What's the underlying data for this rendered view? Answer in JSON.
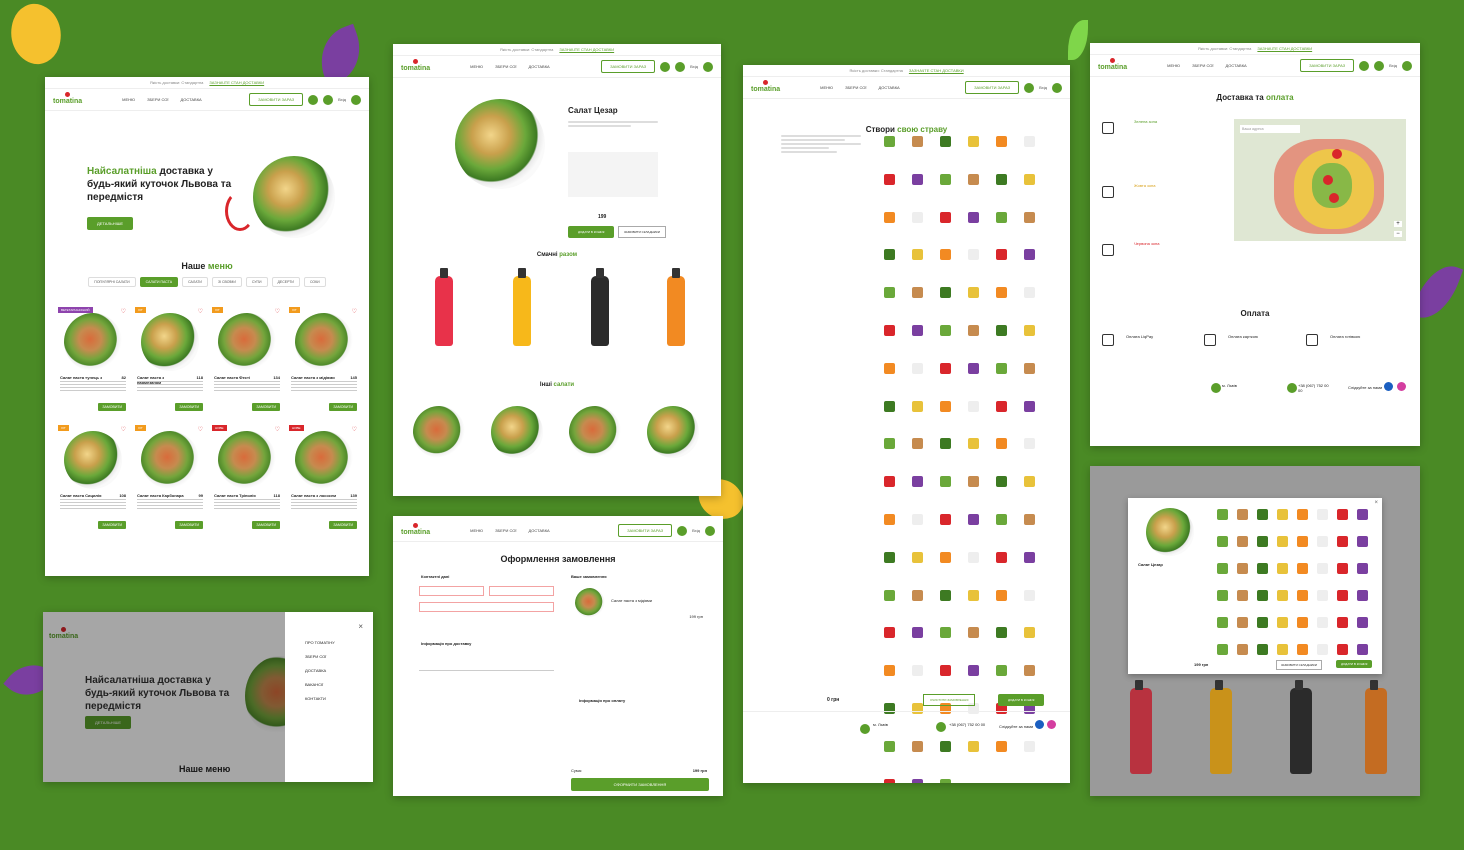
{
  "brand": {
    "name": "tomatina",
    "accent": "#5a9e2a",
    "red": "#d9262b",
    "bg": "#4a8a25"
  },
  "topbar": {
    "text": "Якість доставки: Стандартна",
    "link": "ЗАЗНАЧТЕ СТАН ДОСТАВКИ"
  },
  "nav": {
    "items": [
      "МЕНЮ",
      "ЗБЕРИ СОЇ",
      "ДОСТАВКА"
    ],
    "cta": "ЗАМОВИТИ ЗАРАЗ",
    "login": "Вхід"
  },
  "home": {
    "hero_title_1": "Найсалатніша",
    "hero_title_2": "доставка у будь-який куточок Львова та передмістя",
    "hero_btn": "ДЕТАЛЬНІШЕ",
    "menu_title_1": "Наше",
    "menu_title_2": "меню",
    "tabs": [
      "ПОПУЛЯРНІ САЛАТИ",
      "САЛАТИ ПАСТА",
      "САЛАТИ",
      "ЗІ СВОЇМИ",
      "СУПИ",
      "ДЕСЕРТИ",
      "СОКИ"
    ],
    "cards": [
      {
        "name": "Салат паста тунець з",
        "price": "82",
        "tag": "ВЕГЕТАРІАНСЬКИЙ",
        "tag_type": "p"
      },
      {
        "name": "Салат паста з пармезаном",
        "price": "118",
        "tag": "ХІТ",
        "tag_type": "o"
      },
      {
        "name": "Салат паста Фесті",
        "price": "134",
        "tag": "ХІТ",
        "tag_type": "o"
      },
      {
        "name": "Салат паста з мідіями",
        "price": "145",
        "tag": "ХІТ",
        "tag_type": "o"
      },
      {
        "name": "Салат паста Сицилія",
        "price": "108",
        "tag": "ХІТ",
        "tag_type": "o"
      },
      {
        "name": "Салат паста Карбонара",
        "price": "99",
        "tag": "ХІТ",
        "tag_type": "o"
      },
      {
        "name": "Салат паста Тріполія",
        "price": "118",
        "tag": "НОВЕ",
        "tag_type": "r"
      },
      {
        "name": "Салат паста з лососем",
        "price": "139",
        "tag": "НОВЕ",
        "tag_type": "r"
      }
    ],
    "order_btn": "ЗАМОВИТИ"
  },
  "product": {
    "title": "Салат Цезар",
    "price": "199",
    "add": "ДОДАТИ В КОШИК",
    "more": "ЗАМОВИТИ СКЛАДНИКИ",
    "juices_title_1": "Смачні",
    "juices_title_2": "разом",
    "others_title_1": "Інші",
    "others_title_2": "салати"
  },
  "checkout": {
    "title": "Оформлення замовлення",
    "contact": "Контактні дані",
    "delivery": "Інформація про доставку",
    "payment": "Інформація про оплату",
    "your_order": "Ваше замовлення",
    "item": "Салат паста з мідіями",
    "item_price": "199 грн",
    "total_label": "Сума:",
    "total": "199 грн",
    "submit": "ОФОРМИТИ ЗАМОВЛЕННЯ"
  },
  "builder": {
    "title_1": "Створи",
    "title_2": "свою страву",
    "total": "0 грн",
    "btn1": "ОЧИСТИТИ ЗАМОВЛЕННЯ",
    "btn2": "ДОДАТИ В КОШИК"
  },
  "delivery": {
    "title_1": "Доставка та",
    "title_2": "оплата",
    "zones": [
      "Зелена зона",
      "Жовта зона",
      "Червона зона"
    ],
    "pay_title": "Оплата",
    "pays": [
      "Оплата LiqPay",
      "Оплата карткою",
      "Оплата готівкою"
    ],
    "search": "Ваша адреса"
  },
  "drawer": {
    "items": [
      "ПРО ТОМАТІНУ",
      "ЗБЕРИ СОЇ",
      "ДОСТАВКА",
      "ВАКАНСІЇ",
      "КОНТАКТИ"
    ],
    "hero": "Найсалатніша доставка у будь-який куточок Львова та передмістя",
    "menu": "Наше меню"
  },
  "modal": {
    "title": "Салат Цезар",
    "price": "199 грн",
    "btn1": "ЗАМОВИТИ СКЛАДНИКИ",
    "btn2": "ДОДАТИ В КОШИК"
  },
  "footer": {
    "city": "м. Львів",
    "phone": "+38 (067) 752 00 00",
    "hours": "Пн - Нд 10:00 до 22:00",
    "social": "Слідкуйте за нами"
  }
}
